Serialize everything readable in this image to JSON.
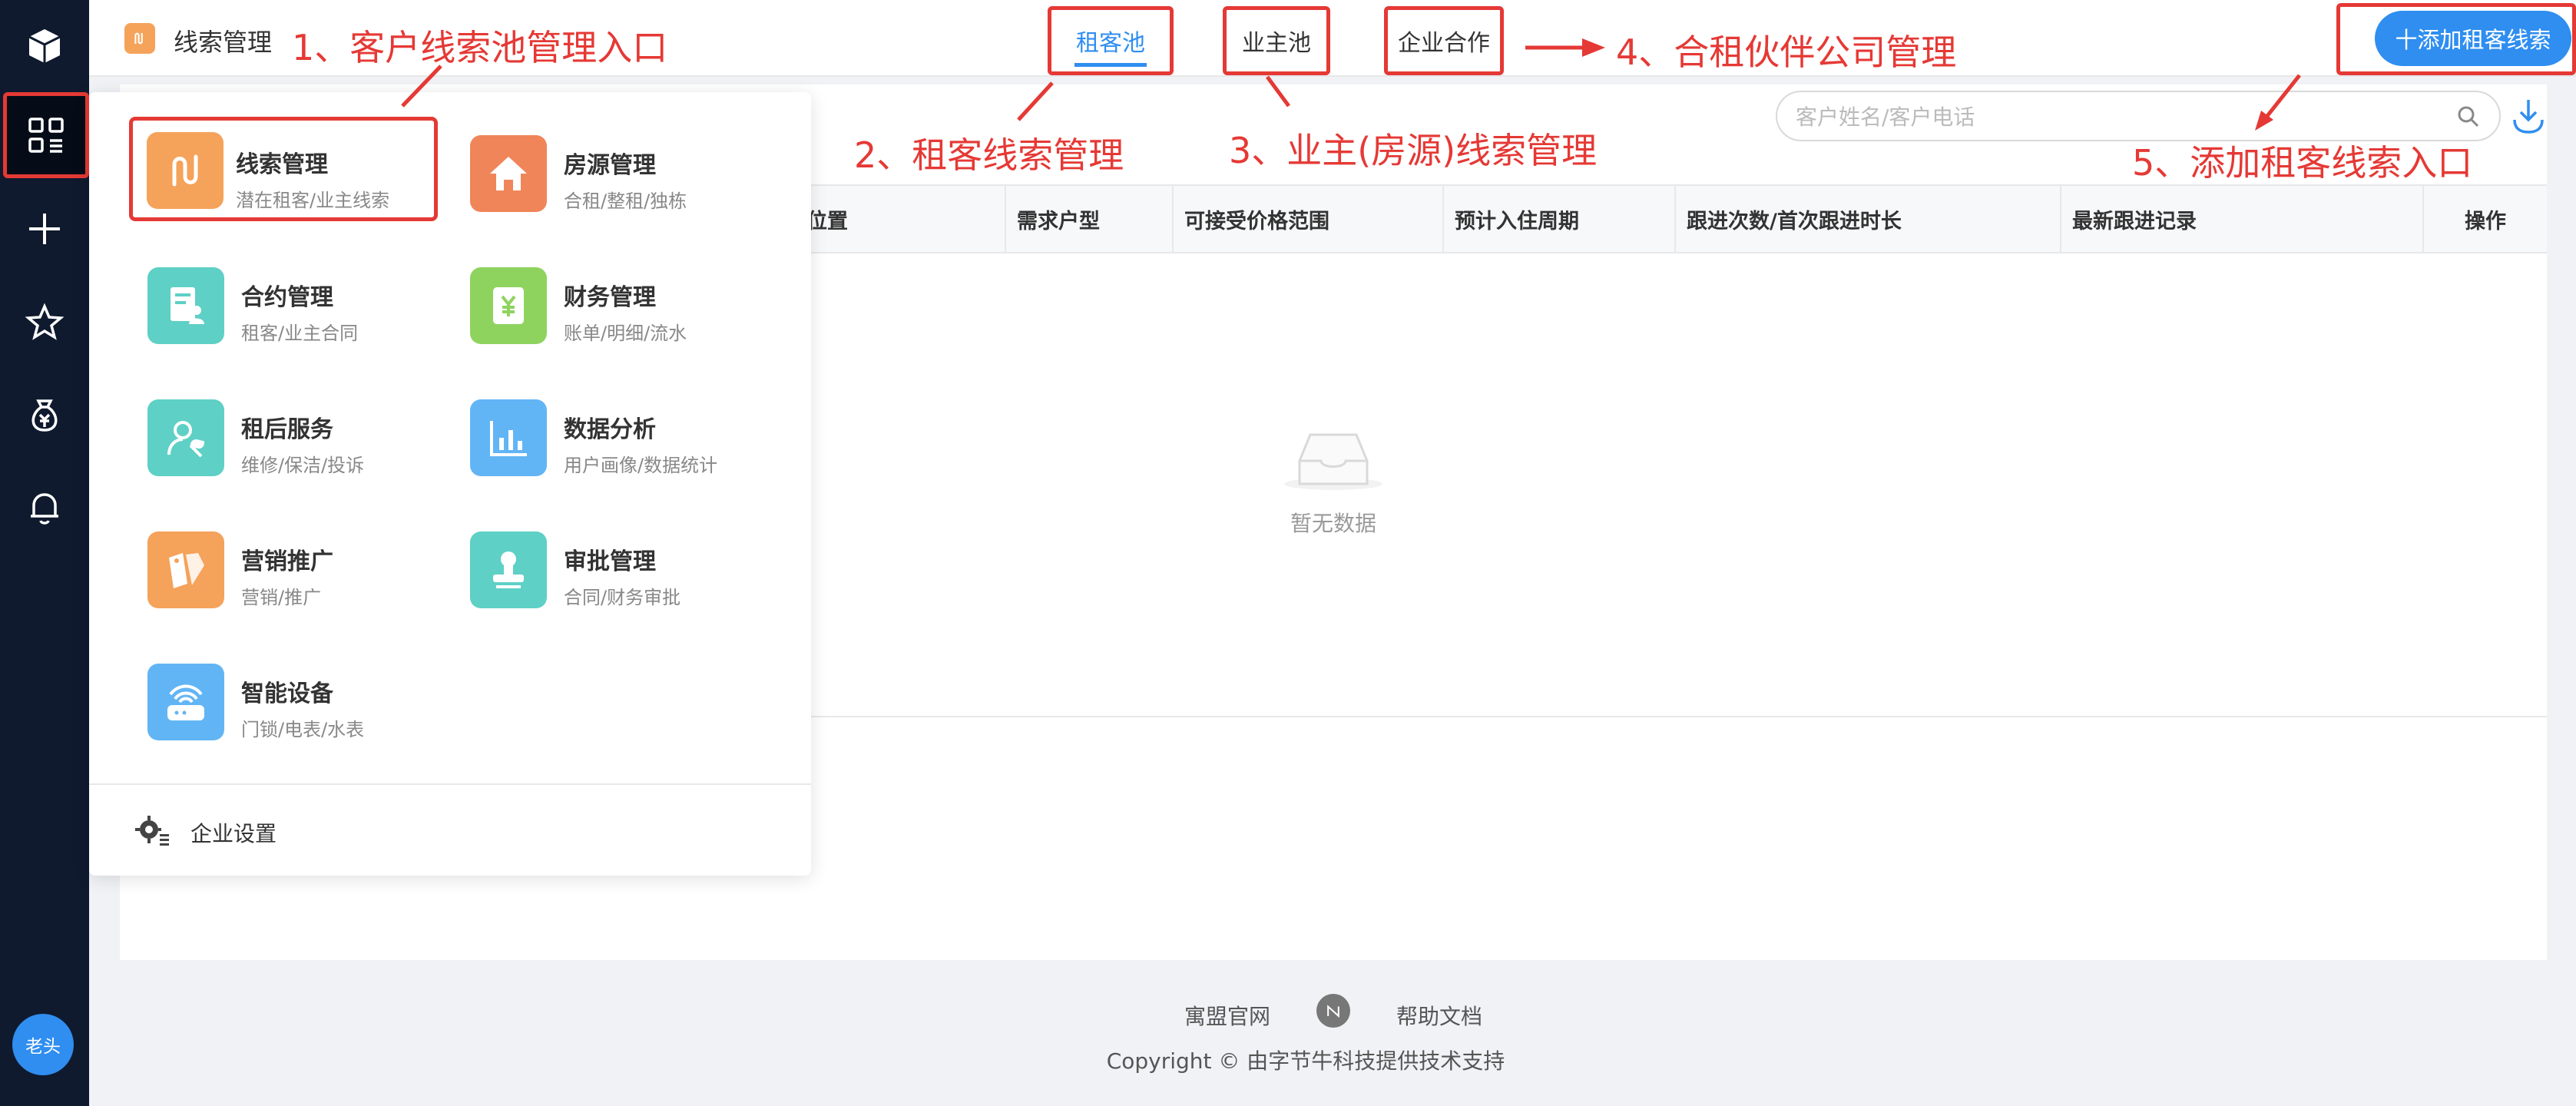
{
  "app": {
    "title": "线索管理"
  },
  "tabs": [
    {
      "label": "租客池",
      "active": true
    },
    {
      "label": "业主池",
      "active": false
    },
    {
      "label": "企业合作",
      "active": false
    }
  ],
  "toolbar": {
    "add_label": "十添加租客线索",
    "search_placeholder": "客户姓名/客户电话"
  },
  "table": {
    "columns": [
      "位置",
      "需求户型",
      "可接受价格范围",
      "预计入住周期",
      "跟进次数/首次跟进时长",
      "最新跟进记录",
      "操作"
    ],
    "empty_text": "暂无数据"
  },
  "menu": {
    "items": [
      {
        "title": "线索管理",
        "subtitle": "潜在租客/业主线索",
        "color": "#f5a25a",
        "icon": "route-icon"
      },
      {
        "title": "房源管理",
        "subtitle": "合租/整租/独栋",
        "color": "#f0855a",
        "icon": "house-icon"
      },
      {
        "title": "合约管理",
        "subtitle": "租客/业主合同",
        "color": "#5ed0c5",
        "icon": "contract-icon"
      },
      {
        "title": "财务管理",
        "subtitle": "账单/明细/流水",
        "color": "#8fd35f",
        "icon": "finance-icon"
      },
      {
        "title": "租后服务",
        "subtitle": "维修/保洁/投诉",
        "color": "#5ed0c5",
        "icon": "service-icon"
      },
      {
        "title": "数据分析",
        "subtitle": "用户画像/数据统计",
        "color": "#62b5f5",
        "icon": "chart-icon"
      },
      {
        "title": "营销推广",
        "subtitle": "营销/推广",
        "color": "#f5a25a",
        "icon": "tag-icon"
      },
      {
        "title": "审批管理",
        "subtitle": "合同/财务审批",
        "color": "#5ed0c5",
        "icon": "stamp-icon"
      },
      {
        "title": "智能设备",
        "subtitle": "门锁/电表/水表",
        "color": "#62b5f5",
        "icon": "router-icon"
      }
    ],
    "footer_label": "企业设置"
  },
  "sidebar": {
    "icons": [
      "cube-icon",
      "apps-icon",
      "plus-icon",
      "star-icon",
      "money-bag-icon",
      "bell-icon"
    ],
    "avatar_text": "老头"
  },
  "footer": {
    "link1": "寓盟官网",
    "link2": "帮助文档",
    "copyright": "Copyright © 由字节牛科技提供技术支持"
  },
  "annotations": {
    "a1": "1、客户线索池管理入口",
    "a2": "2、租客线索管理",
    "a3": "3、业主(房源)线索管理",
    "a4": "4、合租伙伴公司管理",
    "a5": "5、添加租客线索入口"
  },
  "colors": {
    "accent": "#2f8ef0",
    "sidebar": "#0f1a2e",
    "annotation": "#e53935"
  }
}
